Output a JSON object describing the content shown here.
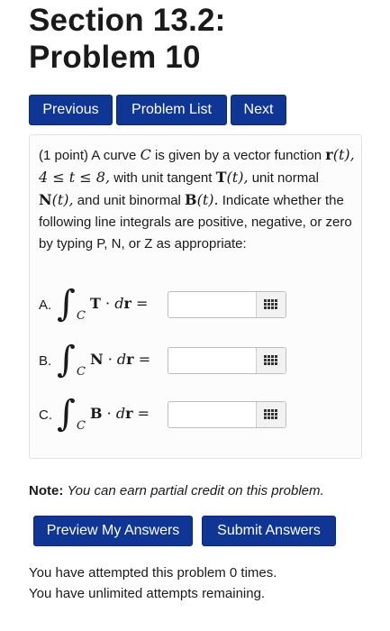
{
  "header": {
    "title_line1": "Section 13.2:",
    "title_line2": "Problem 10"
  },
  "nav": {
    "previous_label": "Previous",
    "problem_list_label": "Problem List",
    "next_label": "Next"
  },
  "problem": {
    "points": "(1 point)",
    "text_1": "A curve",
    "curve_var": "C",
    "text_2": "is given by a vector function",
    "r_bold": "r",
    "r_arg": "(t), 4 ≤ t ≤ 8,",
    "text_3": "with unit tangent",
    "T_bold": "T",
    "T_arg": "(t),",
    "text_4": "unit normal",
    "N_bold": "N",
    "N_arg": "(t),",
    "text_5": "and unit binormal",
    "B_bold": "B",
    "B_arg": "(t).",
    "text_6": "Indicate whether the following line integrals are positive, negative, or zero by typing P, N, or Z as appropriate:",
    "integrals": [
      {
        "label": "A.",
        "integral_sign": "∫",
        "subscript": "C",
        "vector": "T",
        "dot": "·",
        "d": "d",
        "r": "r",
        "equals": "=",
        "value": "",
        "placeholder": ""
      },
      {
        "label": "B.",
        "integral_sign": "∫",
        "subscript": "C",
        "vector": "N",
        "dot": "·",
        "d": "d",
        "r": "r",
        "equals": "=",
        "value": "",
        "placeholder": ""
      },
      {
        "label": "C.",
        "integral_sign": "∫",
        "subscript": "C",
        "vector": "B",
        "dot": "·",
        "d": "d",
        "r": "r",
        "equals": "=",
        "value": "",
        "placeholder": ""
      }
    ]
  },
  "note": {
    "label": "Note:",
    "text": "You can earn partial credit on this problem."
  },
  "actions": {
    "preview_label": "Preview My Answers",
    "submit_label": "Submit Answers"
  },
  "status": {
    "attempts_line": "You have attempted this problem 0 times.",
    "remaining_line": "You have unlimited attempts remaining."
  },
  "colors": {
    "button_bg": "#0f3694",
    "button_text": "#ffffff",
    "panel_border": "#e2e2e2"
  },
  "icons": {
    "answer_palette": "grid-palette-icon"
  }
}
